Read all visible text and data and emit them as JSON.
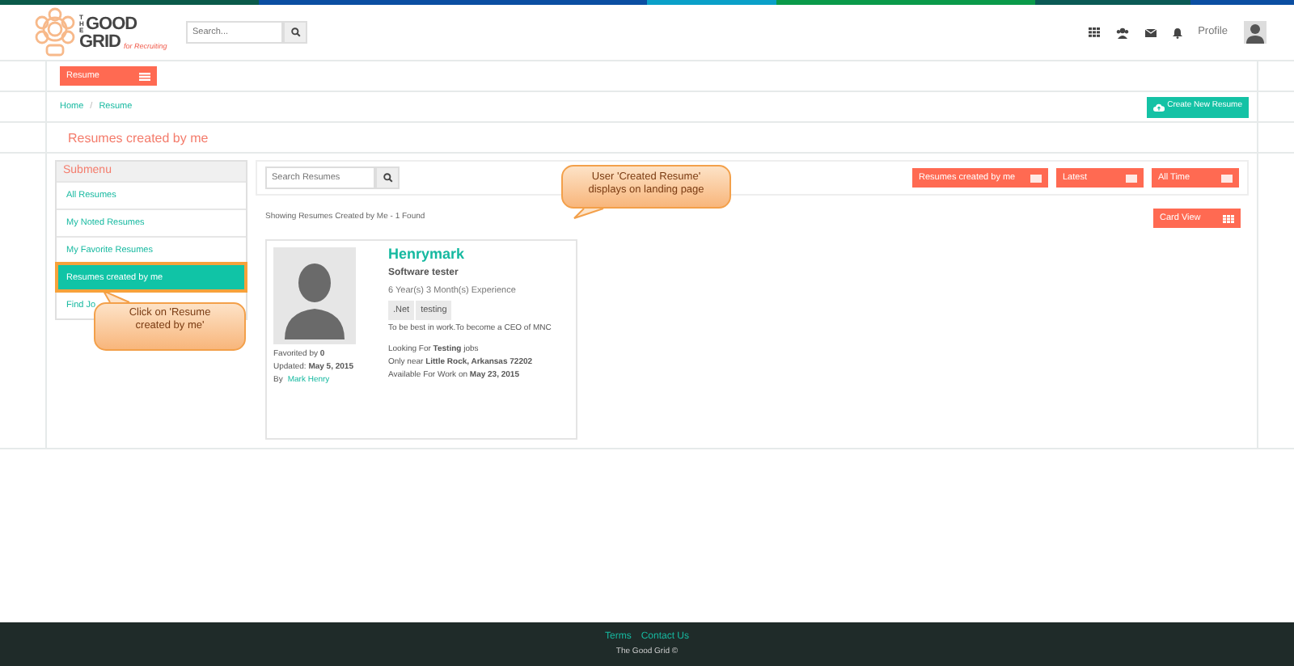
{
  "header": {
    "logo": {
      "the": "THE",
      "good": "GOOD",
      "grid": "GRID",
      "tagline": "for Recruiting"
    },
    "search": {
      "placeholder": "Search..."
    },
    "profile": "Profile"
  },
  "subnav": {
    "menu_button": "Resume"
  },
  "breadcrumb": [
    {
      "label": "Home"
    },
    {
      "label": "Resume"
    }
  ],
  "breadcrumb_separator": "/",
  "create_button": "Create New Resume",
  "page_title": "Resumes created by me",
  "submenu": {
    "title": "Submenu",
    "items": [
      {
        "label": "All Resumes",
        "selected": false
      },
      {
        "label": "My Noted Resumes",
        "selected": false
      },
      {
        "label": "My Favorite Resumes",
        "selected": false
      },
      {
        "label": "Resumes created by me",
        "selected": true
      },
      {
        "label": "Find Jo",
        "selected": false
      }
    ]
  },
  "filters": {
    "search": {
      "placeholder": "Search Resumes"
    },
    "dropdowns": [
      "Resumes created by me",
      "Latest",
      "All Time"
    ]
  },
  "result_summary": "Showing Resumes Created by Me - 1 Found",
  "view_button": "Card View",
  "resumes": [
    {
      "name": "Henrymark",
      "title": "Software tester",
      "experience": "6 Year(s) 3 Month(s) Experience",
      "skills": [
        ".Net",
        "testing"
      ],
      "objective": "To be best in work.To become a CEO of MNC",
      "favorited": "Favorited by **0**",
      "updated": "Updated: **May 5, 2015**",
      "by": "By",
      "author": "Mark Henry",
      "details": [
        "Looking For **Testing** jobs",
        "Only near **Little Rock, Arkansas 72202**",
        "Available For Work on **May 23, 2015**"
      ]
    }
  ],
  "callouts": [
    {
      "text": "Click on 'Resume created by me'"
    },
    {
      "text": "User 'Created Resume' displays on landing page"
    }
  ],
  "footer": {
    "links": [
      "Terms",
      "Contact Us"
    ],
    "copyright": "The Good Grid ©"
  }
}
